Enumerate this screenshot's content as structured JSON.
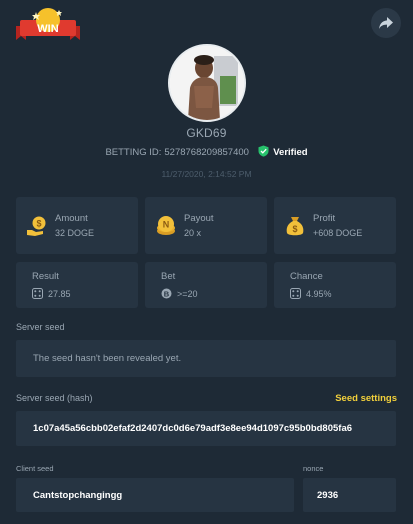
{
  "badge": {
    "text": "WIN"
  },
  "user": {
    "name": "GKD69"
  },
  "bet": {
    "id_label": "BETTING ID:",
    "id_value": "5278768209857400",
    "verified_label": "Verified",
    "timestamp": "11/27/2020, 2:14:52 PM"
  },
  "stats": {
    "amount": {
      "label": "Amount",
      "value": "32 DOGE"
    },
    "payout": {
      "label": "Payout",
      "value": "20 x"
    },
    "profit": {
      "label": "Profit",
      "value": "+608 DOGE"
    }
  },
  "details": {
    "result": {
      "label": "Result",
      "value": "27.85"
    },
    "bet": {
      "label": "Bet",
      "value": ">=20"
    },
    "chance": {
      "label": "Chance",
      "value": "4.95%"
    }
  },
  "seeds": {
    "server_seed_label": "Server seed",
    "server_seed_value": "The seed hasn't been revealed yet.",
    "server_hash_label": "Server seed (hash)",
    "seed_settings_label": "Seed settings",
    "server_hash_value": "1c07a45a56cbb02efaf2d2407dc0d6e79adf3e8ee94d1097c95b0bd805fa6",
    "client_seed_label": "Client seed",
    "client_seed_value": "Cantstopchangingg",
    "nonce_label": "nonce",
    "nonce_value": "2936"
  },
  "colors": {
    "background": "#1e2a36",
    "card": "#263442",
    "accent_gold": "#f2d03b",
    "verified_green": "#27c26c"
  },
  "icons": [
    "win-ribbon-icon",
    "share-icon",
    "shield-check-icon",
    "coin-hand-icon",
    "coin-n-icon",
    "money-bag-icon",
    "dice-icon",
    "b-coin-icon"
  ]
}
